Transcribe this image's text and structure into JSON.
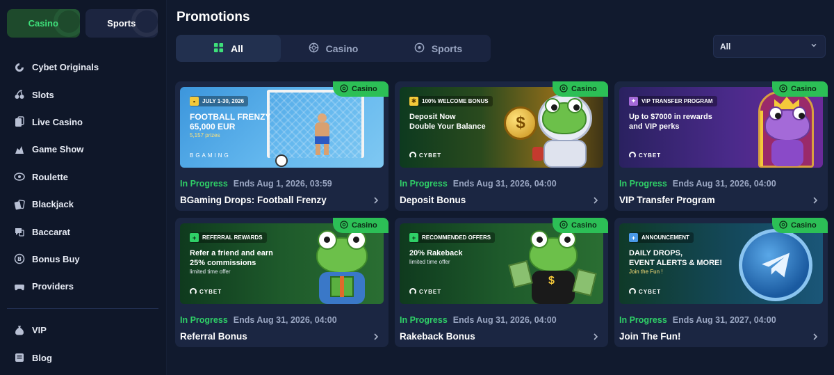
{
  "sidebar": {
    "toggle": {
      "casino": "Casino",
      "sports": "Sports"
    },
    "items": [
      {
        "label": "Cybet Originals",
        "icon": "cybet-logo-icon"
      },
      {
        "label": "Slots",
        "icon": "cherries-icon"
      },
      {
        "label": "Live Casino",
        "icon": "live-cards-icon"
      },
      {
        "label": "Game Show",
        "icon": "game-show-icon"
      },
      {
        "label": "Roulette",
        "icon": "roulette-icon"
      },
      {
        "label": "Blackjack",
        "icon": "cards-icon"
      },
      {
        "label": "Baccarat",
        "icon": "chat-cards-icon"
      },
      {
        "label": "Bonus Buy",
        "icon": "coin-icon"
      },
      {
        "label": "Providers",
        "icon": "gamepad-icon"
      }
    ],
    "items2": [
      {
        "label": "VIP",
        "icon": "money-bag-icon"
      },
      {
        "label": "Blog",
        "icon": "blog-icon"
      }
    ]
  },
  "main": {
    "title": "Promotions",
    "tabs": [
      {
        "label": "All",
        "icon": "grid-icon",
        "active": true
      },
      {
        "label": "Casino",
        "icon": "casino-chip-icon",
        "active": false
      },
      {
        "label": "Sports",
        "icon": "soccer-ball-icon",
        "active": false
      }
    ],
    "filter": {
      "value": "All",
      "icon": "chevron-down-icon"
    }
  },
  "cards": [
    {
      "badge": "Casino",
      "tag": "JULY 1-30, 2026",
      "headline": "FOOTBALL FRENZY\n65,000 EUR",
      "subline": "5,157 prizes",
      "brand": "BGAMING",
      "status": "In Progress",
      "ends": "Ends Aug 1, 2026, 03:59",
      "title": "BGaming Drops: Football Frenzy"
    },
    {
      "badge": "Casino",
      "tag": "100% WELCOME BONUS",
      "headline": "Deposit Now\nDouble Your Balance",
      "subline": "",
      "brand": "CYBET",
      "status": "In Progress",
      "ends": "Ends Aug 31, 2026, 04:00",
      "title": "Deposit Bonus"
    },
    {
      "badge": "Casino",
      "tag": "VIP TRANSFER PROGRAM",
      "headline": "Up to $7000 in rewards\nand VIP perks",
      "subline": "",
      "brand": "CYBET",
      "status": "In Progress",
      "ends": "Ends Aug 31, 2026, 04:00",
      "title": "VIP Transfer Program"
    },
    {
      "badge": "Casino",
      "tag": "REFERRAL REWARDS",
      "headline": "Refer a friend and earn\n25% commissions",
      "subline": "limited time offer",
      "brand": "CYBET",
      "status": "In Progress",
      "ends": "Ends Aug 31, 2026, 04:00",
      "title": "Referral Bonus"
    },
    {
      "badge": "Casino",
      "tag": "RECOMMENDED OFFERS",
      "headline": "20% Rakeback",
      "subline": "limited time offer",
      "brand": "CYBET",
      "status": "In Progress",
      "ends": "Ends Aug 31, 2026, 04:00",
      "title": "Rakeback Bonus"
    },
    {
      "badge": "Casino",
      "tag": "ANNOUNCEMENT",
      "headline": "DAILY DROPS,\nEVENT ALERTS & MORE!",
      "subline": "Join the Fun !",
      "brand": "CYBET",
      "status": "In Progress",
      "ends": "Ends Aug 31, 2027, 04:00",
      "title": "Join The Fun!"
    }
  ],
  "colors": {
    "accent_green": "#2fd067",
    "badge_green": "#2cbf56",
    "background": "#111a2e",
    "card": "#1b2642"
  }
}
